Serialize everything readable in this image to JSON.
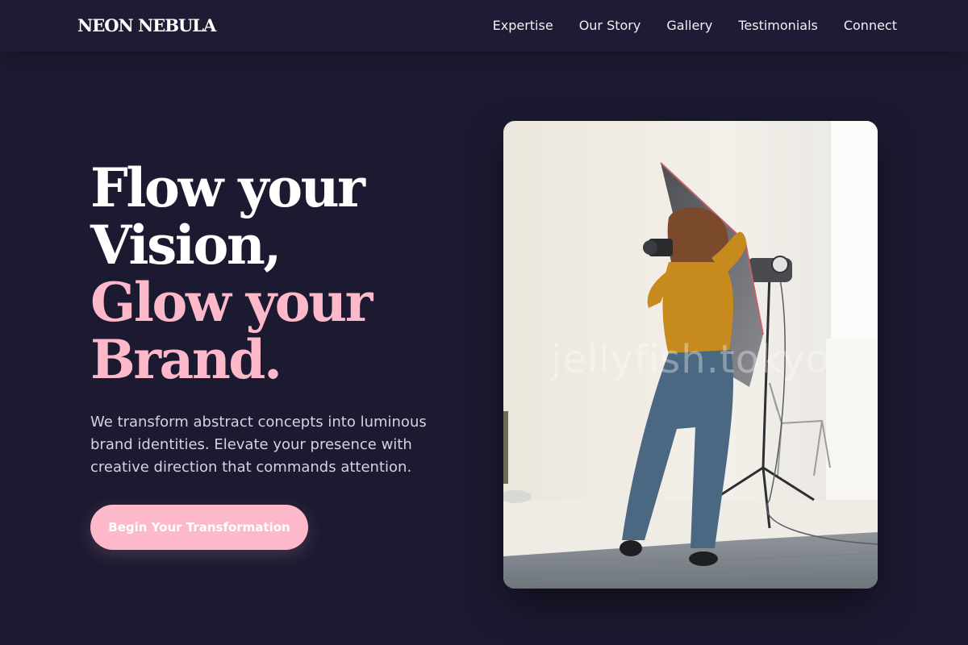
{
  "brand": {
    "logo": "NEON NEBULA"
  },
  "nav": {
    "items": [
      "Expertise",
      "Our Story",
      "Gallery",
      "Testimonials",
      "Connect"
    ]
  },
  "hero": {
    "line1": "Flow your",
    "line2": "Vision,",
    "line3": "Glow your",
    "line4": "Brand.",
    "description": "We transform abstract concepts into luminous brand identities. Elevate your presence with creative direction that commands attention.",
    "cta_label": "Begin Your Transformation",
    "image_watermark": "jellyfish.tokyo"
  },
  "colors": {
    "background": "#1c1a31",
    "accent_pink": "#fdb8c9",
    "text_white": "#ffffff"
  },
  "icons": {
    "hero_image": "photo-studio-photographer-image"
  }
}
